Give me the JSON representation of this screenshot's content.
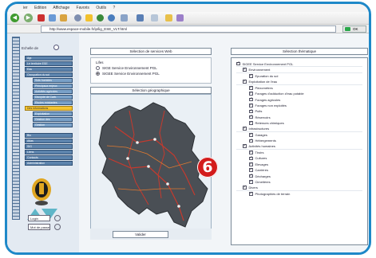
{
  "menubar": {
    "items": [
      "ier",
      "Edition",
      "Affichage",
      "Favoris",
      "Outils",
      "?"
    ]
  },
  "address": {
    "url": "http://www.espace-mobile.fr/ip/lig_ESE_VLT.html",
    "go_label": "OK"
  },
  "left_panel": {
    "scale_name": "Echelle de",
    "nav_items": [
      {
        "label": "Agr.",
        "type": "main"
      },
      {
        "label": "Le territoire ESE",
        "type": "main"
      },
      {
        "label": "Eau",
        "type": "main"
      },
      {
        "label": "Occupation du sol",
        "type": "main"
      },
      {
        "label": "Sols humides",
        "type": "sub"
      },
      {
        "label": "Principaux enjeux",
        "type": "sub"
      },
      {
        "label": "Activités agricoles",
        "type": "sub"
      },
      {
        "label": "Dioxyde de Carb.",
        "type": "sub"
      },
      {
        "label": "Etudes existantes",
        "type": "sub"
      },
      {
        "label": "Des informations",
        "type": "active"
      },
      {
        "label": "Exploitation",
        "type": "sub"
      },
      {
        "label": "Gestion des",
        "type": "sub"
      },
      {
        "label": "Gestion",
        "type": "sub"
      },
      {
        "label": "Bio",
        "type": "main"
      },
      {
        "label": "Atlas",
        "type": "main"
      },
      {
        "label": "SIG",
        "type": "main"
      },
      {
        "label": "Liens",
        "type": "main"
      },
      {
        "label": "Contacts",
        "type": "main"
      },
      {
        "label": "Administration",
        "type": "main"
      }
    ],
    "login_label": "Login",
    "password_label": "Mot de passe"
  },
  "center_panel": {
    "services_title": "Sélection de services Web",
    "services_label": "Lifes",
    "services": [
      {
        "label": "SIGE Service Environnement PGL",
        "selected": false
      },
      {
        "label": "SIGEE Service Environnement PGL",
        "selected": true
      }
    ],
    "map_title": "Sélection géographique",
    "validate_label": "Valider"
  },
  "marker": {
    "number": "6",
    "color": "#d31c1c"
  },
  "right_panel": {
    "title": "Sélection thématique",
    "items": [
      {
        "label": "SIGEE Service Environnement PGL",
        "level": 0,
        "checked": true,
        "group": true
      },
      {
        "label": "Environnement",
        "level": 1,
        "checked": true,
        "group": true
      },
      {
        "label": "Epuration du sol",
        "level": 2,
        "checked": true
      },
      {
        "label": "Exploitation de l'eau",
        "level": 1,
        "checked": true,
        "group": true
      },
      {
        "label": "Piézomètres",
        "level": 2,
        "checked": true
      },
      {
        "label": "Forages d'adduction d'eau potable",
        "level": 2,
        "checked": true
      },
      {
        "label": "Forages agricoles",
        "level": 2,
        "checked": true
      },
      {
        "label": "Forages non exploités",
        "level": 2,
        "checked": true
      },
      {
        "label": "Puits",
        "level": 2,
        "checked": true
      },
      {
        "label": "Réservoirs",
        "level": 2,
        "checked": true
      },
      {
        "label": "Retenues chimiques",
        "level": 2,
        "checked": true
      },
      {
        "label": "Infrastructures",
        "level": 1,
        "checked": true,
        "group": true
      },
      {
        "label": "Garages",
        "level": 2,
        "checked": true
      },
      {
        "label": "Hébergements",
        "level": 2,
        "checked": true
      },
      {
        "label": "Activités humaines",
        "level": 1,
        "checked": true,
        "group": true
      },
      {
        "label": "Tiroirs",
        "level": 2,
        "checked": true
      },
      {
        "label": "Cultures",
        "level": 2,
        "checked": true
      },
      {
        "label": "Elevages",
        "level": 2,
        "checked": true
      },
      {
        "label": "Carrières",
        "level": 2,
        "checked": true
      },
      {
        "label": "Décharges",
        "level": 2,
        "checked": true
      },
      {
        "label": "Cimetières",
        "level": 2,
        "checked": true
      },
      {
        "label": "Divers",
        "level": 1,
        "checked": true,
        "group": true
      },
      {
        "label": "Photographies de terrain",
        "level": 2,
        "checked": true
      }
    ]
  },
  "colors": {
    "accent": "#1e88c8",
    "nav": "#5d84ad",
    "nav_active": "#f4c431",
    "map_land": "#4a4f55",
    "roads": "#c53a2e"
  },
  "icons": [
    "back-icon",
    "forward-icon",
    "stop-icon",
    "refresh-icon",
    "home-icon",
    "search-icon",
    "favorites-icon",
    "media-icon",
    "history-icon",
    "mail-icon",
    "print-icon",
    "edit-icon",
    "go-icon",
    "logo-badge-icon",
    "zoom-in-icon",
    "zoom-out-icon"
  ]
}
